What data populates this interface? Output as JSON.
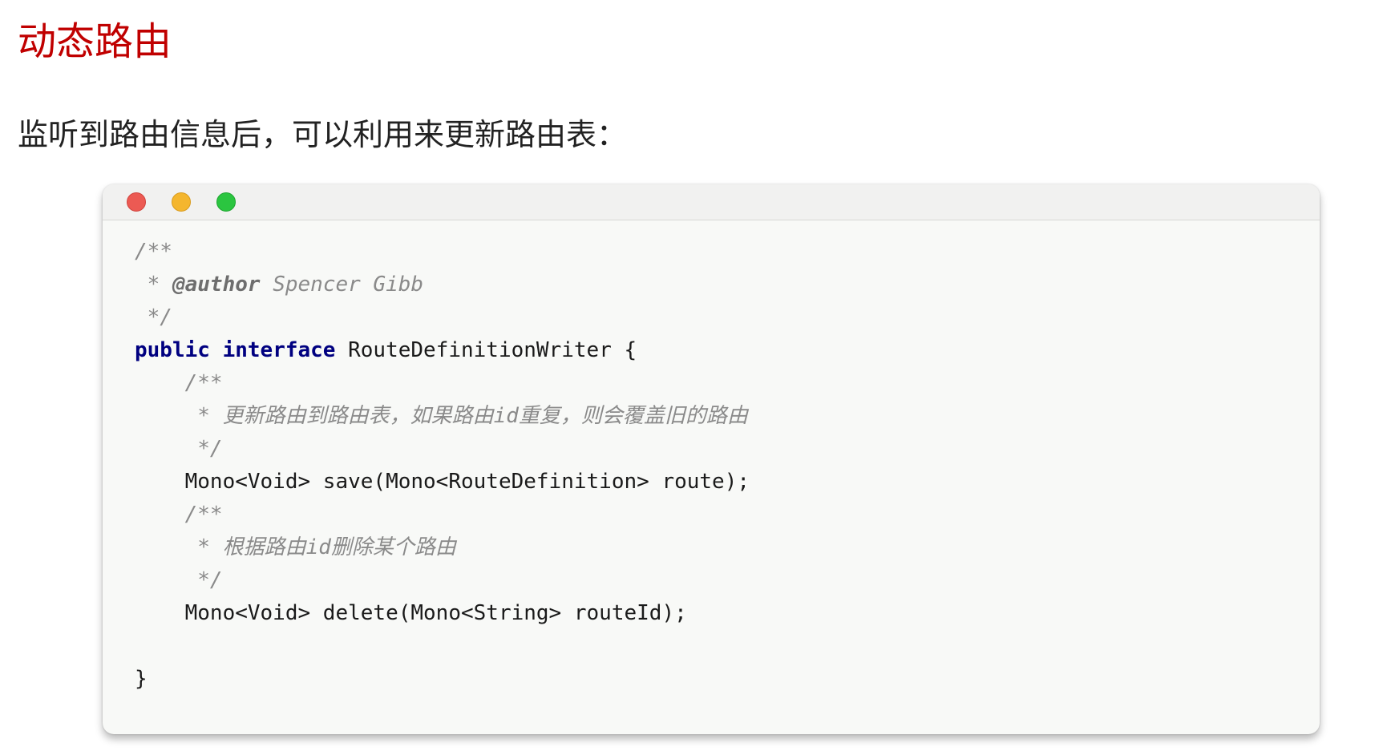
{
  "heading": "动态路由",
  "paragraph": "监听到路由信息后，可以利用来更新路由表：",
  "code": {
    "line1": "/**",
    "line2_prefix": " * ",
    "line2_tag": "@author",
    "line2_rest": " Spencer Gibb",
    "line3": " */",
    "line4_kw1": "public",
    "line4_kw2": "interface",
    "line4_rest": " RouteDefinitionWriter {",
    "line5": "    /**",
    "line6": "     * 更新路由到路由表，如果路由id重复，则会覆盖旧的路由",
    "line7": "     */",
    "line8": "    Mono<Void> save(Mono<RouteDefinition> route);",
    "line9": "    /**",
    "line10": "     * 根据路由id删除某个路由",
    "line11": "     */",
    "line12": "    Mono<Void> delete(Mono<String> routeId);",
    "line13": "",
    "line14": "}"
  }
}
